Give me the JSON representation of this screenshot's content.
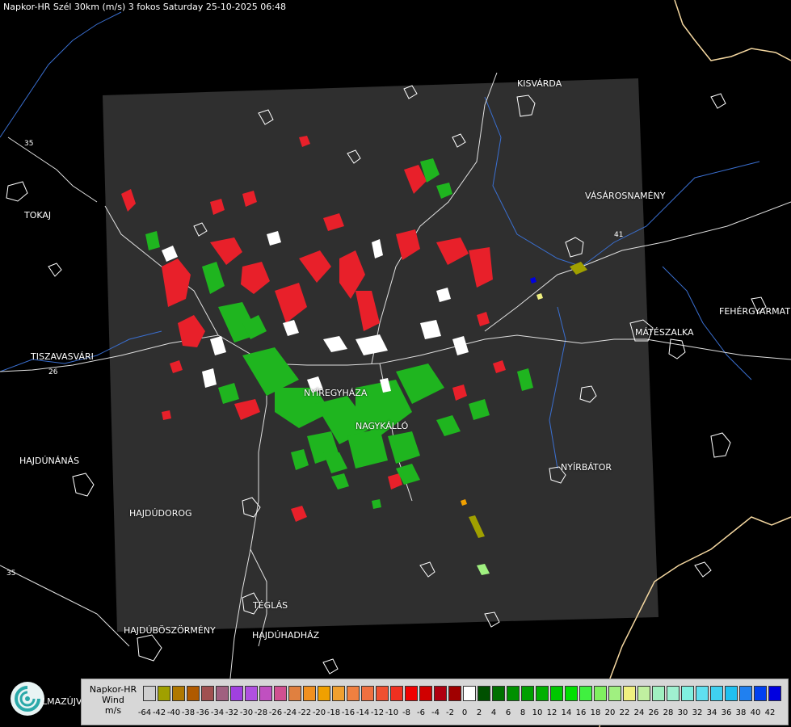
{
  "title": "Napkor-HR Szél 30km (m/s) 3 fokos Saturday 25-10-2025 06:48",
  "cities": [
    {
      "name": "KISVÁRDA"
    },
    {
      "name": "VÁSÁROSNAMÉNY"
    },
    {
      "name": "TOKAJ"
    },
    {
      "name": "FEHÉRGYARMAT"
    },
    {
      "name": "MÁTÉSZALKA"
    },
    {
      "name": "TISZAVASVÁRI"
    },
    {
      "name": "NYÍREGYHÁZA"
    },
    {
      "name": "NAGYKÁLLÓ"
    },
    {
      "name": "NYÍRBÁTOR"
    },
    {
      "name": "HAJDÚNÁNÁS"
    },
    {
      "name": "HAJDÚDOROG"
    },
    {
      "name": "TÉGLÁS"
    },
    {
      "name": "HAJDÚBÖSZÖRMÉNY"
    },
    {
      "name": "HAJDÚHADHÁZ"
    },
    {
      "name": "LMAZÚJVÁR"
    }
  ],
  "road_labels": [
    "35",
    "26",
    "41",
    "35"
  ],
  "legend": {
    "line1": "Napkor-HR",
    "line2": "Wind",
    "line3": "m/s",
    "ticks": [
      "-64",
      "-42",
      "-40",
      "-38",
      "-36",
      "-34",
      "-32",
      "-30",
      "-28",
      "-26",
      "-24",
      "-22",
      "-20",
      "-18",
      "-16",
      "-14",
      "-12",
      "-10",
      "-8",
      "-6",
      "-4",
      "-2",
      "0",
      "2",
      "4",
      "6",
      "8",
      "10",
      "12",
      "14",
      "16",
      "18",
      "20",
      "22",
      "24",
      "26",
      "28",
      "30",
      "32",
      "34",
      "36",
      "38",
      "40",
      "42"
    ],
    "colors": [
      "#cfcfcf",
      "#a0a000",
      "#b07800",
      "#b05a00",
      "#a05050",
      "#a06080",
      "#a040e0",
      "#b050e0",
      "#c050c0",
      "#d05090",
      "#e08040",
      "#f09020",
      "#f0a000",
      "#f0a030",
      "#f08040",
      "#f07040",
      "#f05030",
      "#f03020",
      "#f00000",
      "#d00000",
      "#b00010",
      "#a00000",
      "#ffffff",
      "#005000",
      "#007000",
      "#009000",
      "#00a000",
      "#00b000",
      "#00c800",
      "#00e000",
      "#40f040",
      "#80f060",
      "#a0f080",
      "#f0f080",
      "#c0f0a0",
      "#a0f0c0",
      "#a0f0d0",
      "#80f0e0",
      "#60e0f0",
      "#40d0f0",
      "#20c0f0",
      "#2080f0",
      "#0040f0",
      "#0000e0"
    ]
  },
  "colors": {
    "radar_bg": "#2f2f2f",
    "border": "#f4d7a0",
    "river": "#3a6fd0",
    "outline": "#ffffff"
  }
}
